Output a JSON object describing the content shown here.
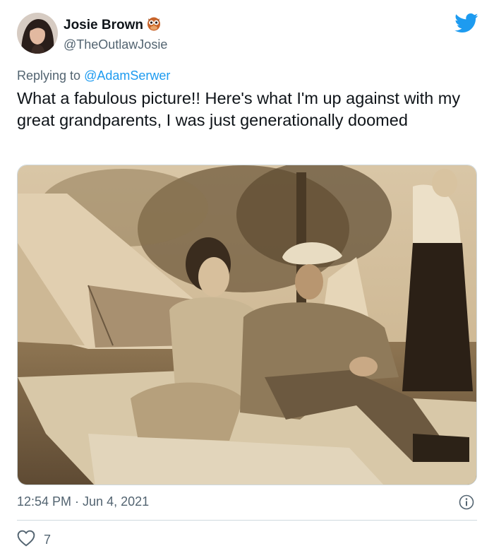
{
  "author": {
    "display_name": "Josie Brown",
    "handle": "@TheOutlawJosie",
    "badge_icon": "owl-emoji-icon"
  },
  "reply": {
    "prefix": "Replying to ",
    "to_handle": "@AdamSerwer"
  },
  "tweet": {
    "text": "What a fabulous picture!! Here's what I'm up against with my great grandparents, I was just generationally doomed"
  },
  "meta": {
    "time": "12:54 PM",
    "separator": "·",
    "date": "Jun 4, 2021"
  },
  "stats": {
    "likes": "7"
  },
  "colors": {
    "twitter_blue": "#1d9bf0",
    "secondary_text": "#536471",
    "primary_text": "#0f1419",
    "photo_sepia": "#b89a72"
  }
}
